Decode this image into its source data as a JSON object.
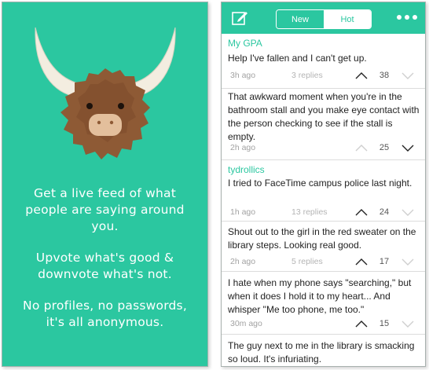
{
  "promo": {
    "lines": [
      "Get a live feed of what",
      "people are saying around",
      "you.",
      "Upvote what's good &",
      "downvote what's not.",
      "No profiles, no passwords,",
      "it's all anonymous."
    ]
  },
  "tabs": {
    "new_label": "New",
    "hot_label": "Hot",
    "selected": "Hot"
  },
  "colors": {
    "brand": "#2bc7a0",
    "active_arrow": "#222222",
    "inactive_arrow": "#cfcfcf"
  },
  "feed": {
    "posts": [
      {
        "author": "My GPA",
        "text": "Help I've fallen and I can't get up.",
        "time": "3h ago",
        "replies": "3 replies",
        "votes": "38",
        "upvoted": true
      },
      {
        "author": "",
        "text": "That awkward moment when you're in the bathroom stall and you make eye contact with the person checking to see if the stall is empty.",
        "time": "2h ago",
        "replies": "",
        "votes": "25",
        "upvoted": false
      },
      {
        "author": "tydrollics",
        "text": "I tried to FaceTime campus police last night.",
        "time": "1h ago",
        "replies": "13 replies",
        "votes": "24",
        "upvoted": true
      },
      {
        "author": "",
        "text": "Shout out to the girl in the red sweater on the library steps. Looking real good.",
        "time": "2h ago",
        "replies": "5 replies",
        "votes": "17",
        "upvoted": true
      },
      {
        "author": "",
        "text": "I hate when my phone says \"searching,\" but when it does I hold it to my heart... And whisper \"Me too phone, me too.\"",
        "time": "30m ago",
        "replies": "",
        "votes": "15",
        "upvoted": true
      },
      {
        "author": "",
        "text": "The guy next to me in the library is smacking so loud. It's infuriating.",
        "time": "",
        "replies": "",
        "votes": "",
        "upvoted": false
      }
    ]
  }
}
